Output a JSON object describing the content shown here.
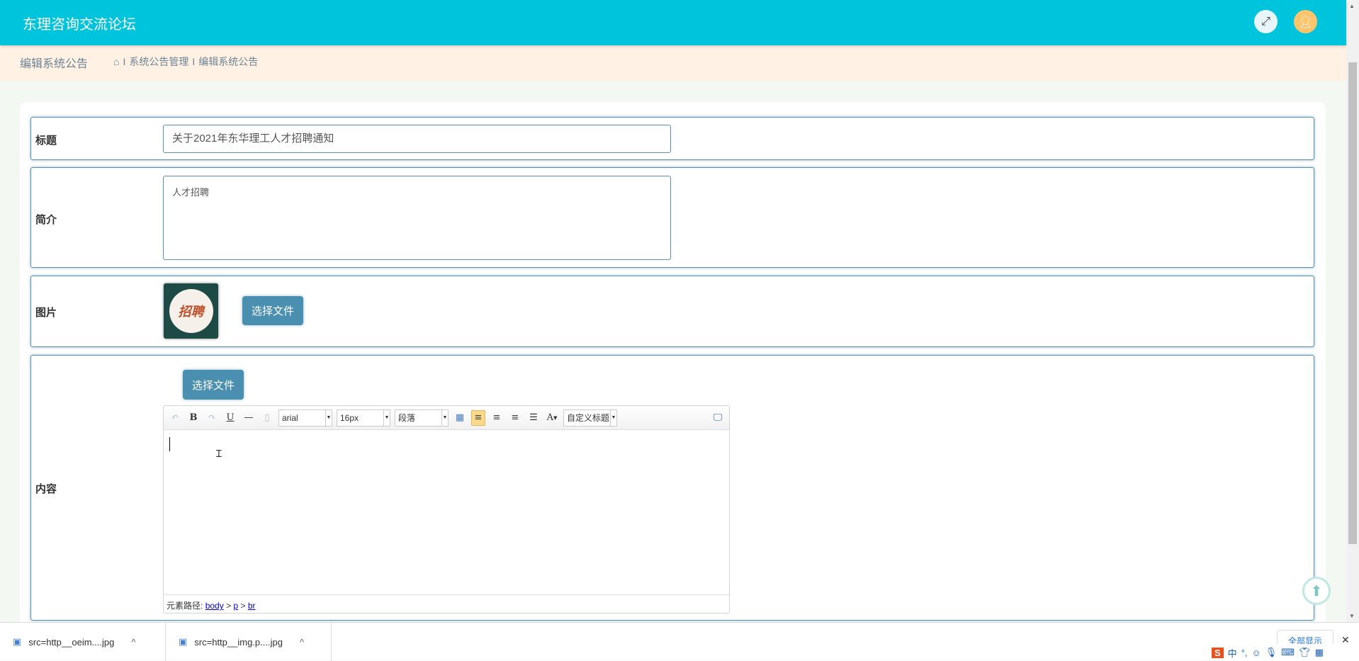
{
  "header": {
    "title": "东理咨询交流论坛",
    "fullscreen_icon": "expand-icon",
    "user_icon": "user-icon",
    "accent": "#00c4dc"
  },
  "breadcrumb": {
    "page_title": "编辑系统公告",
    "items": [
      "系统公告管理",
      "编辑系统公告"
    ],
    "separator": "I"
  },
  "form": {
    "title": {
      "label": "标题",
      "value": "关于2021年东华理工人才招聘通知"
    },
    "intro": {
      "label": "简介",
      "value": "人才招聘"
    },
    "image": {
      "label": "图片",
      "thumb_text": "招聘",
      "button": "选择文件"
    },
    "content": {
      "label": "内容",
      "button": "选择文件",
      "toolbar": {
        "bold": "B",
        "underline": "U",
        "hr": "—",
        "font": "arial",
        "size": "16px",
        "paragraph": "段落",
        "fontcolor": "A",
        "custom_title": "自定义标题"
      },
      "status_prefix": "元素路径:",
      "path": [
        "body",
        "p",
        "br"
      ],
      "path_sep": ">"
    }
  },
  "downloads": {
    "items": [
      "src=http__oeim....jpg",
      "src=http__img.p....jpg"
    ],
    "show_all": "全部显示",
    "close": "✕"
  },
  "ime": {
    "label": "中"
  }
}
